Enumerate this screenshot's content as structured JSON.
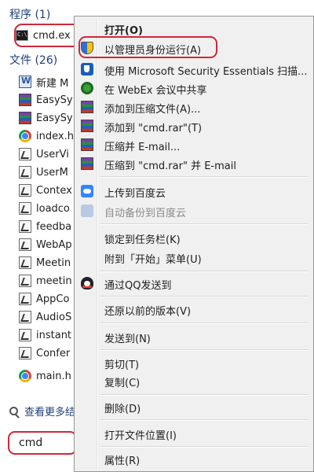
{
  "results": {
    "programs_header": "程序 (1)",
    "cmd_item": "cmd.ex",
    "files_header": "文件 (26)",
    "files": [
      {
        "label": "新建 M",
        "icon": "word-doc-icon"
      },
      {
        "label": "EasySy",
        "icon": "winrar-icon"
      },
      {
        "label": "EasySy",
        "icon": "winrar-icon"
      },
      {
        "label": "index.h",
        "icon": "chrome-icon"
      },
      {
        "label": "UserVi",
        "icon": "script-file-icon"
      },
      {
        "label": "UserM",
        "icon": "script-file-icon"
      },
      {
        "label": "Contex",
        "icon": "script-file-icon"
      },
      {
        "label": "loadco",
        "icon": "script-file-icon"
      },
      {
        "label": "feedba",
        "icon": "script-file-icon"
      },
      {
        "label": "WebAp",
        "icon": "script-file-icon"
      },
      {
        "label": "Meetin",
        "icon": "script-file-icon"
      },
      {
        "label": "meetin",
        "icon": "script-file-icon"
      },
      {
        "label": "AppCo",
        "icon": "script-file-icon"
      },
      {
        "label": "AudioS",
        "icon": "script-file-icon"
      },
      {
        "label": "instant",
        "icon": "script-file-icon"
      },
      {
        "label": "Confer",
        "icon": "script-file-icon"
      },
      {
        "label": "main.h",
        "icon": "chrome-icon"
      }
    ],
    "see_more": "查看更多结果"
  },
  "search": {
    "value": "cmd"
  },
  "context_menu": {
    "items": [
      {
        "label": "打开(O)",
        "bold": true,
        "icon": ""
      },
      {
        "label": "以管理员身份运行(A)",
        "icon": "uac-shield-icon"
      },
      {
        "label": "使用 Microsoft Security Essentials 扫描...",
        "icon": "mse-icon"
      },
      {
        "label": "在 WebEx 会议中共享",
        "icon": "webex-icon"
      },
      {
        "label": "添加到压缩文件(A)...",
        "icon": "winrar-icon"
      },
      {
        "label": "添加到 \"cmd.rar\"(T)",
        "icon": "winrar-icon"
      },
      {
        "label": "压缩并 E-mail...",
        "icon": "winrar-icon"
      },
      {
        "label": "压缩到 \"cmd.rar\" 并 E-mail",
        "icon": "winrar-icon"
      },
      {
        "label": "上传到百度云",
        "icon": "baidu-cloud-icon"
      },
      {
        "label": "自动备份到百度云",
        "icon": "baidu-cloud-icon",
        "disabled": true
      },
      {
        "label": "锁定到任务栏(K)",
        "icon": ""
      },
      {
        "label": "附到「开始」菜单(U)",
        "icon": ""
      },
      {
        "label": "通过QQ发送到",
        "icon": "qq-icon"
      },
      {
        "label": "还原以前的版本(V)",
        "icon": ""
      },
      {
        "label": "发送到(N)",
        "icon": ""
      },
      {
        "label": "剪切(T)",
        "icon": ""
      },
      {
        "label": "复制(C)",
        "icon": ""
      },
      {
        "label": "删除(D)",
        "icon": ""
      },
      {
        "label": "打开文件位置(I)",
        "icon": ""
      },
      {
        "label": "属性(R)",
        "icon": ""
      }
    ]
  },
  "colors": {
    "highlight_circle": "#d0283a",
    "menu_background": "#f0f0f0",
    "header_text": "#1e3f7a"
  }
}
